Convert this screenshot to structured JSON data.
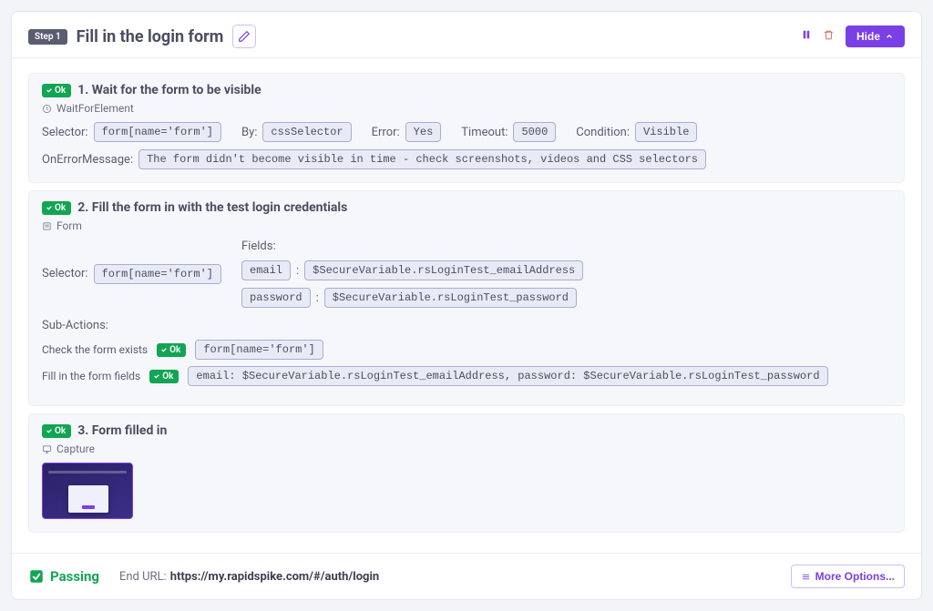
{
  "header": {
    "step_badge": "Step 1",
    "title": "Fill in the login form",
    "hide_label": "Hide"
  },
  "steps": [
    {
      "ok": "Ok",
      "title": "1. Wait for the form to be visible",
      "type": "WaitForElement",
      "selector_label": "Selector:",
      "selector": "form[name='form']",
      "by_label": "By:",
      "by": "cssSelector",
      "error_label": "Error:",
      "error": "Yes",
      "timeout_label": "Timeout:",
      "timeout": "5000",
      "condition_label": "Condition:",
      "condition": "Visible",
      "onerror_label": "OnErrorMessage:",
      "onerror": "The form didn't become visible in time - check screenshots, videos and CSS selectors"
    },
    {
      "ok": "Ok",
      "title": "2. Fill the form in with the test login credentials",
      "type": "Form",
      "selector_label": "Selector:",
      "selector": "form[name='form']",
      "fields_label": "Fields:",
      "fields": [
        {
          "name": "email",
          "sep": ":",
          "value": "$SecureVariable.rsLoginTest_emailAddress"
        },
        {
          "name": "password",
          "sep": ":",
          "value": "$SecureVariable.rsLoginTest_password"
        }
      ],
      "subactions_label": "Sub-Actions:",
      "subactions": [
        {
          "label": "Check the form exists",
          "ok": "Ok",
          "value": "form[name='form']"
        },
        {
          "label": "Fill in the form fields",
          "ok": "Ok",
          "value": "email: $SecureVariable.rsLoginTest_emailAddress, password: $SecureVariable.rsLoginTest_password"
        }
      ]
    },
    {
      "ok": "Ok",
      "title": "3. Form filled in",
      "type": "Capture"
    }
  ],
  "footer": {
    "status": "Passing",
    "endurl_label": "End URL:",
    "endurl": "https://my.rapidspike.com/#/auth/login",
    "more_label": "More Options..."
  }
}
